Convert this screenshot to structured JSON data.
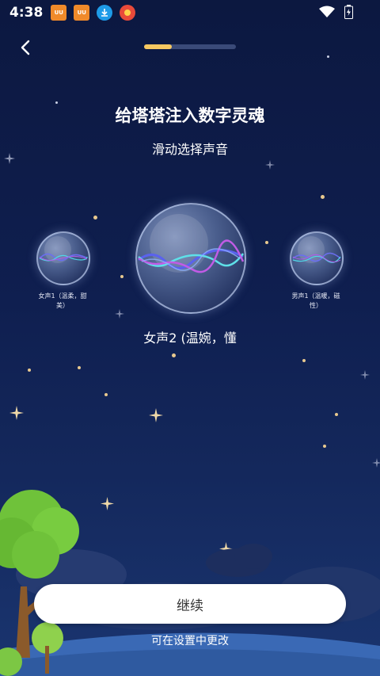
{
  "status_bar": {
    "time": "4:38",
    "app_icons": [
      {
        "name": "uu-booster-icon",
        "color": "#f08a2a",
        "text": "UU"
      },
      {
        "name": "uu-booster-icon-2",
        "color": "#f08a2a",
        "text": "UU"
      },
      {
        "name": "download-icon",
        "color": "#1e9be8",
        "text": ""
      },
      {
        "name": "red-app-icon",
        "color": "#e84a3a",
        "text": ""
      }
    ]
  },
  "header": {
    "progress_percent": 30
  },
  "main": {
    "title": "给塔塔注入数字灵魂",
    "subtitle": "滑动选择声音",
    "voices": [
      {
        "label": "女声1（温柔，甜美）"
      },
      {
        "label": "女声2 (温婉，懂"
      },
      {
        "label": "男声1（温暖，磁性）"
      }
    ],
    "left_label_line1": "女声1（温柔，甜",
    "left_label_line2": "美）",
    "right_label_line1": "男声1（温暖，磁",
    "right_label_line2": "性）",
    "selected_label": "女声2 (温婉，懂"
  },
  "footer": {
    "continue_label": "继续",
    "hint": "可在设置中更改"
  },
  "colors": {
    "accent": "#f7c861",
    "background_top": "#0c1840",
    "button_bg": "#ffffff",
    "tree": "#6fc23a"
  }
}
